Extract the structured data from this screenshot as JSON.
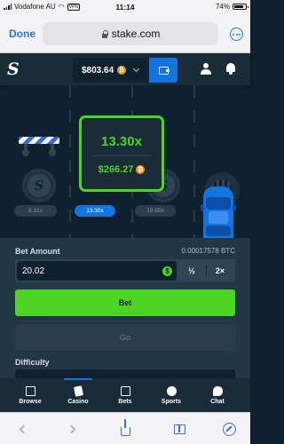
{
  "status_bar": {
    "carrier": "Vodafone AU",
    "vpn": "VPN",
    "time": "11:14",
    "battery": "74%"
  },
  "browser": {
    "done_label": "Done",
    "url": "stake.com",
    "toolbar_icons": [
      "back-arrow-icon",
      "forward-arrow-icon",
      "share-icon",
      "bookmarks-icon",
      "compass-icon"
    ]
  },
  "header": {
    "logo": "S",
    "balance": "$803.64",
    "currency_icon": "₿",
    "icons": [
      "wallet-icon",
      "user-icon",
      "bell-icon"
    ]
  },
  "game": {
    "current_multiplier": "13.30x",
    "current_profit": "$266.27",
    "lane_multipliers": [
      {
        "label": "9.31x",
        "active": false
      },
      {
        "label": "13.30x",
        "active": true
      },
      {
        "label": "19.95x",
        "active": false
      }
    ],
    "cover_logo": "S"
  },
  "controls": {
    "bet_amount_label": "Bet Amount",
    "btc_amount": "0.00017578 BTC",
    "bet_value": "20.02",
    "dollar_symbol": "$",
    "half_label": "½",
    "double_label": "2×",
    "bet_button": "Bet",
    "go_button": "Go",
    "difficulty_label": "Difficulty"
  },
  "tabs": [
    {
      "label": "Browse",
      "icon": "browse-icon",
      "active": false
    },
    {
      "label": "Casino",
      "icon": "casino-icon",
      "active": true
    },
    {
      "label": "Bets",
      "icon": "bets-icon",
      "active": false
    },
    {
      "label": "Sports",
      "icon": "sports-icon",
      "active": false
    },
    {
      "label": "Chat",
      "icon": "chat-icon",
      "active": false
    }
  ],
  "colors": {
    "accent_green": "#4ed424",
    "accent_blue": "#1475e1",
    "background": "#0f212e",
    "panel": "#213743"
  }
}
